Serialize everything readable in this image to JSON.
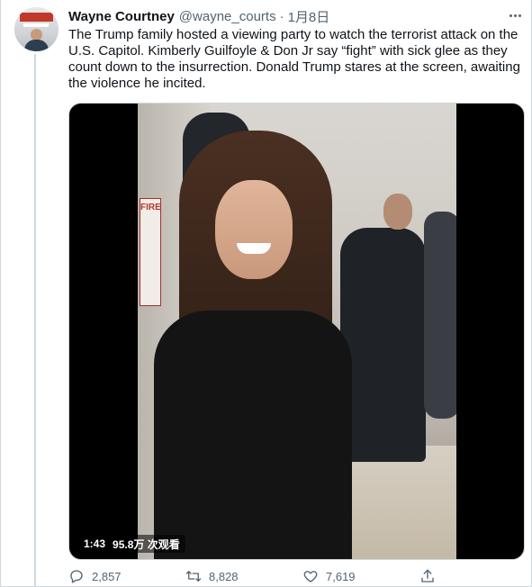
{
  "author": {
    "name": "Wayne Courtney",
    "handle": "@wayne_courts",
    "separator": "·",
    "date": "1月8日"
  },
  "tweet": {
    "text": "The Trump family hosted a viewing party to watch the terrorist attack on the U.S. Capitol. Kimberly Guilfoyle & Don Jr say “fight” with sick glee as they count down to the insurrection. Donald Trump stares at the screen, awaiting the violence he incited."
  },
  "video": {
    "duration": "1:43",
    "views": "95.8万 次观看",
    "sign_text": "FIRE"
  },
  "actions": {
    "replies": "2,857",
    "retweets": "8,828",
    "likes": "7,619"
  },
  "icons": [
    "more-icon",
    "reply-icon",
    "retweet-icon",
    "like-icon",
    "share-icon"
  ],
  "colors": {
    "text": "#0f1419",
    "secondary": "#536471",
    "border": "#cfd9de"
  }
}
